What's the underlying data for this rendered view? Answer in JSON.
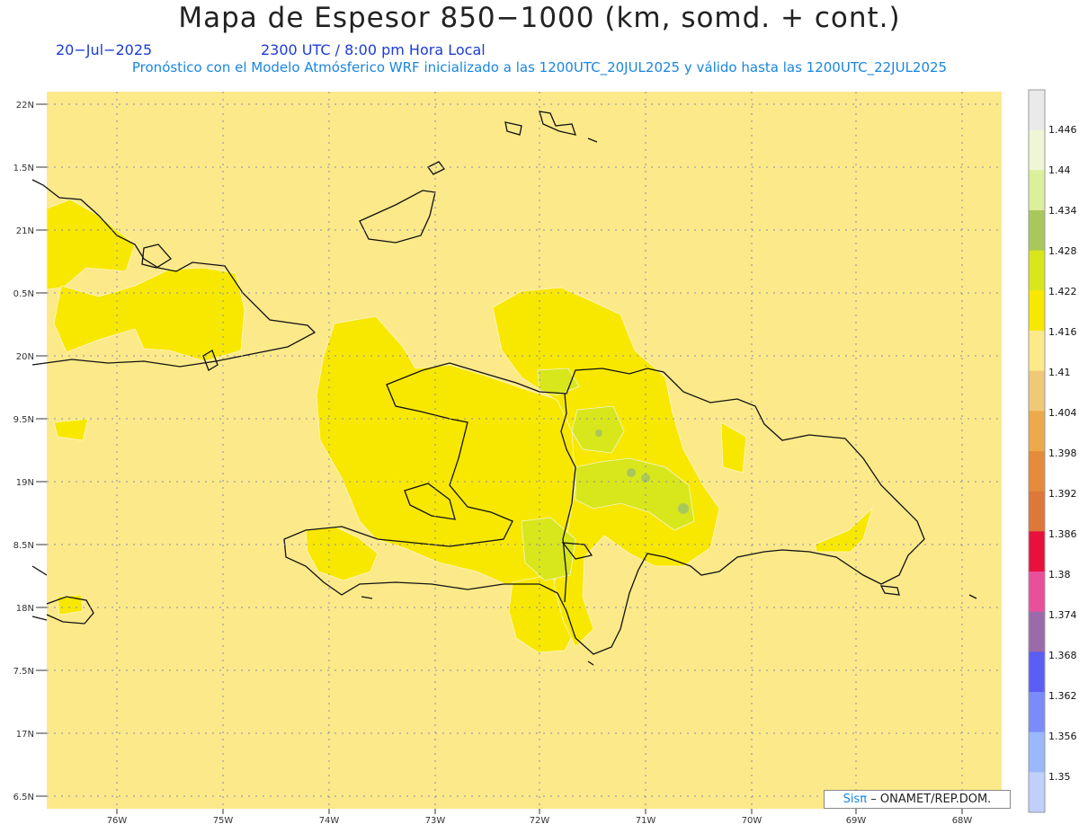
{
  "header": {
    "title": "Mapa de Espesor 850−1000 (km, somd. + cont.)",
    "date": "20−Jul−2025",
    "time": "2300 UTC / 8:00 pm Hora Local",
    "forecast_line": "Pronóstico con el Modelo Atmósferico WRF inicializado a las 1200UTC_20JUL2025 y válido hasta las  1200UTC_22JUL2025"
  },
  "axes": {
    "lat_labels": [
      "22N",
      "1.5N",
      "21N",
      "0.5N",
      "20N",
      "9.5N",
      "19N",
      "8.5N",
      "18N",
      "7.5N",
      "17N",
      "6.5N"
    ],
    "lon_labels": [
      "76W",
      "75W",
      "74W",
      "73W",
      "72W",
      "71W",
      "70W",
      "69W",
      "68W"
    ]
  },
  "legend": {
    "labels": [
      "1.446",
      "1.44",
      "1.434",
      "1.428",
      "1.422",
      "1.416",
      "1.41",
      "1.404",
      "1.398",
      "1.392",
      "1.386",
      "1.38",
      "1.374",
      "1.368",
      "1.362",
      "1.356",
      "1.35"
    ],
    "colors": [
      "#eaeaea",
      "#eef6d6",
      "#dcef9c",
      "#a8c85c",
      "#d8e61c",
      "#f8e800",
      "#fce98a",
      "#f0c878",
      "#ecaa4c",
      "#e48c3c",
      "#dc7838",
      "#e8103c",
      "#e8509c",
      "#9a6aaa",
      "#5a5ef4",
      "#7a8cfa",
      "#9ab8fc",
      "#c0cffc"
    ]
  },
  "credit": {
    "sis": "Sisπ",
    "text": "– ONAMET/REP.DOM."
  }
}
